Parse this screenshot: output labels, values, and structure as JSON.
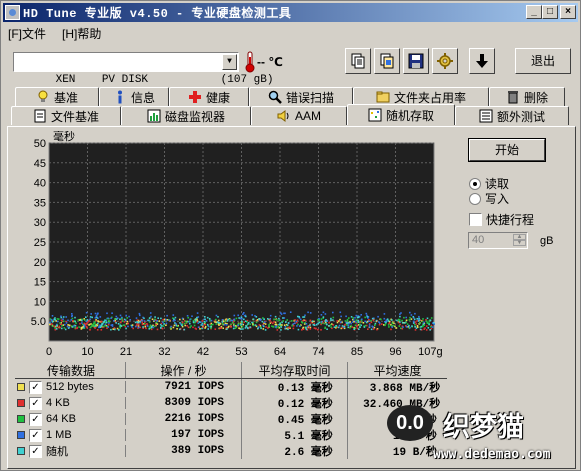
{
  "window": {
    "title": "HD Tune 专业版 v4.50 - 专业硬盘检测工具",
    "min_label": "_",
    "max_label": "□",
    "close_label": "×"
  },
  "menu": [
    {
      "label": "[F]文件"
    },
    {
      "label": "[H]帮助"
    }
  ],
  "toolbar": {
    "drive": "XEN    PV DISK           (107 gB)",
    "temp": "--  ℃",
    "exit_label": "退出",
    "icons": [
      "copy-text-icon",
      "copy-screenshot-icon",
      "save-icon",
      "options-icon",
      "down-arrow-icon"
    ]
  },
  "tabs_row1": [
    {
      "label": "基准",
      "icon": "lightbulb-icon"
    },
    {
      "label": "信息",
      "icon": "info-icon"
    },
    {
      "label": "健康",
      "icon": "health-icon"
    },
    {
      "label": "错误扫描",
      "icon": "magnifier-icon"
    },
    {
      "label": "文件夹占用率",
      "icon": "folder-icon"
    },
    {
      "label": "删除",
      "icon": "trash-icon"
    }
  ],
  "tabs_row2": [
    {
      "label": "文件基准",
      "icon": "file-icon"
    },
    {
      "label": "磁盘监视器",
      "icon": "monitor-icon"
    },
    {
      "label": "AAM",
      "icon": "speaker-icon"
    },
    {
      "label": "随机存取",
      "icon": "random-access-icon",
      "active": true
    },
    {
      "label": "额外测试",
      "icon": "extra-test-icon"
    }
  ],
  "side": {
    "start_label": "开始",
    "read_label": "读取",
    "write_label": "写入",
    "short_stroke_label": "快捷行程",
    "stroke_value": "40",
    "stroke_unit": "gB",
    "read_selected": true,
    "short_stroke_checked": false
  },
  "chart_data": {
    "type": "scatter",
    "ylabel": "毫秒",
    "ylim": [
      0,
      50
    ],
    "yticks": [
      "50",
      "45",
      "40",
      "35",
      "30",
      "25",
      "20",
      "15",
      "10",
      "5.0"
    ],
    "xticks": [
      "0",
      "10",
      "21",
      "32",
      "42",
      "53",
      "64",
      "74",
      "85",
      "96",
      "107gB"
    ],
    "xlim": [
      0,
      107
    ],
    "grid": true,
    "background": "#1a1a1a",
    "series": [
      {
        "name": "512 bytes",
        "color": "#f0e050",
        "band": [
          3.2,
          5.8
        ]
      },
      {
        "name": "4 KB",
        "color": "#e03030",
        "band": [
          3.0,
          5.6
        ]
      },
      {
        "name": "64 KB",
        "color": "#20c040",
        "band": [
          3.4,
          6.2
        ]
      },
      {
        "name": "1 MB",
        "color": "#3070e0",
        "band": [
          3.6,
          7.5
        ]
      },
      {
        "name": "随机",
        "color": "#40d0d0",
        "band": [
          3.0,
          6.4
        ]
      }
    ]
  },
  "results": {
    "headers": [
      "传输数据",
      "操作 / 秒",
      "平均存取时间",
      "平均速度"
    ],
    "rows": [
      {
        "label": "512 bytes",
        "color": "#f0e050",
        "ops": "7921",
        "ops_unit": "IOPS",
        "time": "0.13",
        "time_unit": "毫秒",
        "speed": "3.868",
        "speed_unit": "MB/秒",
        "checked": true
      },
      {
        "label": "4 KB",
        "color": "#e03030",
        "ops": "8309",
        "ops_unit": "IOPS",
        "time": "0.12",
        "time_unit": "毫秒",
        "speed": "32.460",
        "speed_unit": "MB/秒",
        "checked": true
      },
      {
        "label": "64 KB",
        "color": "#20c040",
        "ops": "2216",
        "ops_unit": "IOPS",
        "time": "0.45",
        "time_unit": "毫秒",
        "speed": "13",
        "speed_unit": "B/秒",
        "checked": true
      },
      {
        "label": "1 MB",
        "color": "#3070e0",
        "ops": "197",
        "ops_unit": "IOPS",
        "time": "5.1",
        "time_unit": "毫秒",
        "speed": "19",
        "speed_unit": "B/秒",
        "checked": true
      },
      {
        "label": "随机",
        "color": "#40d0d0",
        "ops": "389",
        "ops_unit": "IOPS",
        "time": "2.6",
        "time_unit": "毫秒",
        "speed": "19",
        "speed_unit": "B/秒",
        "checked": true
      }
    ]
  },
  "watermark": {
    "logo_text": "0.0",
    "brand": "织梦猫",
    "url": "www.dedemao.com"
  }
}
